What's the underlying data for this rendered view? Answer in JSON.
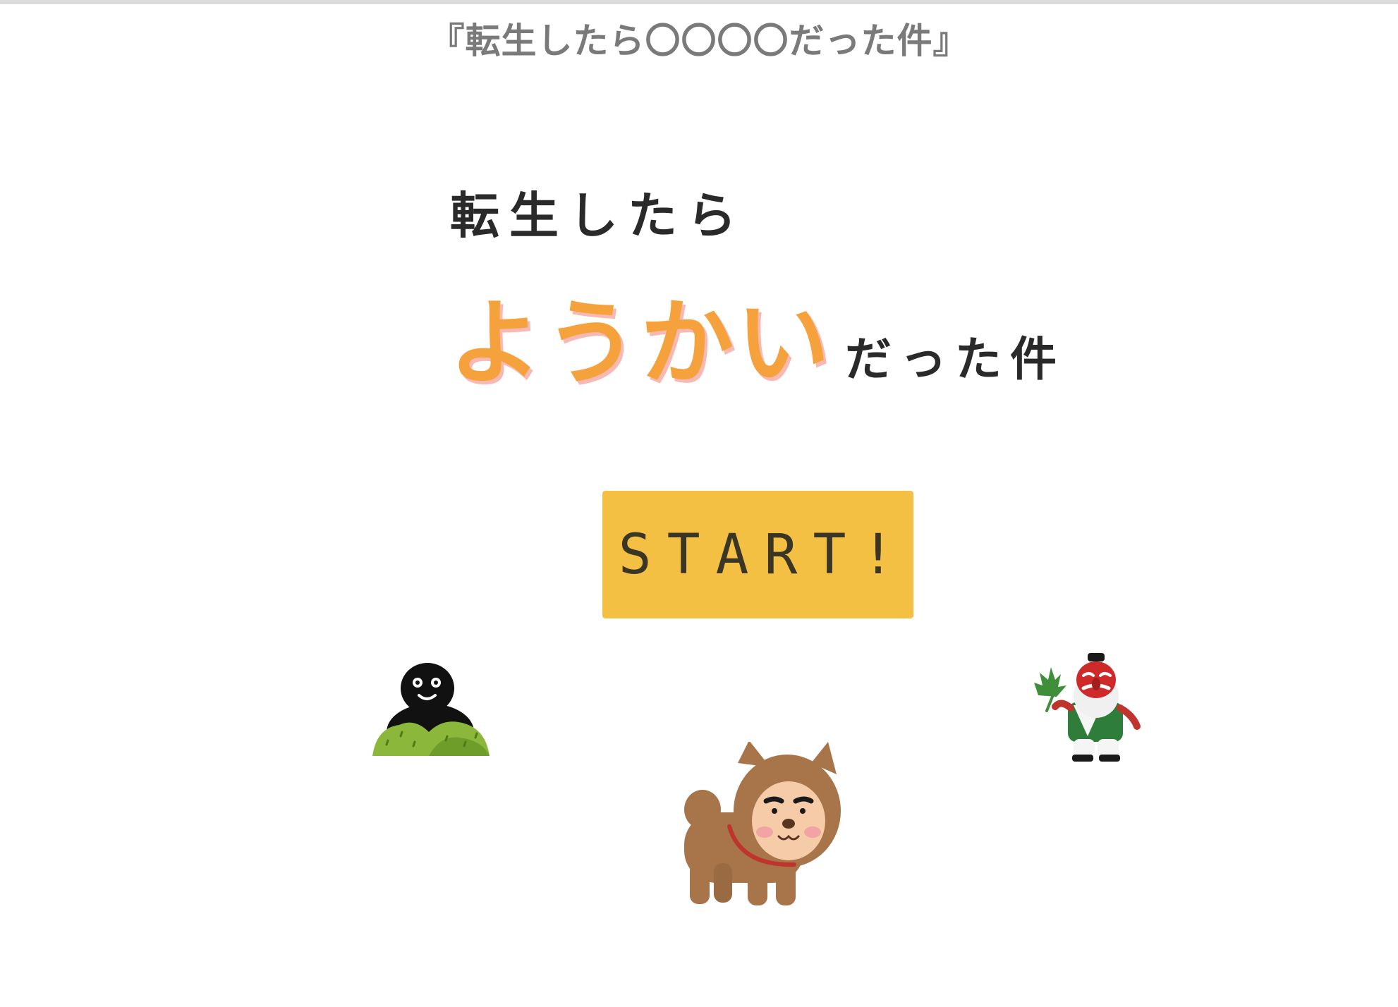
{
  "page": {
    "header": "『転生したら〇〇〇〇だった件』"
  },
  "title": {
    "line1": "転生したら",
    "highlight": "ようかい",
    "suffix": "だった件"
  },
  "start_button": {
    "label": "START!"
  },
  "characters": [
    {
      "name": "shadow-creature-in-bush",
      "icon": "shadow-yokai-icon"
    },
    {
      "name": "dog-with-human-face",
      "icon": "jinmenken-icon"
    },
    {
      "name": "tengu",
      "icon": "tengu-icon"
    }
  ],
  "colors": {
    "header_text": "#7a7a7a",
    "title_text": "#2a2a2a",
    "highlight": "#f5a23c",
    "highlight_shadow": "#f8b9b5",
    "button_bg": "#f4c043",
    "button_text": "#3b3524"
  }
}
